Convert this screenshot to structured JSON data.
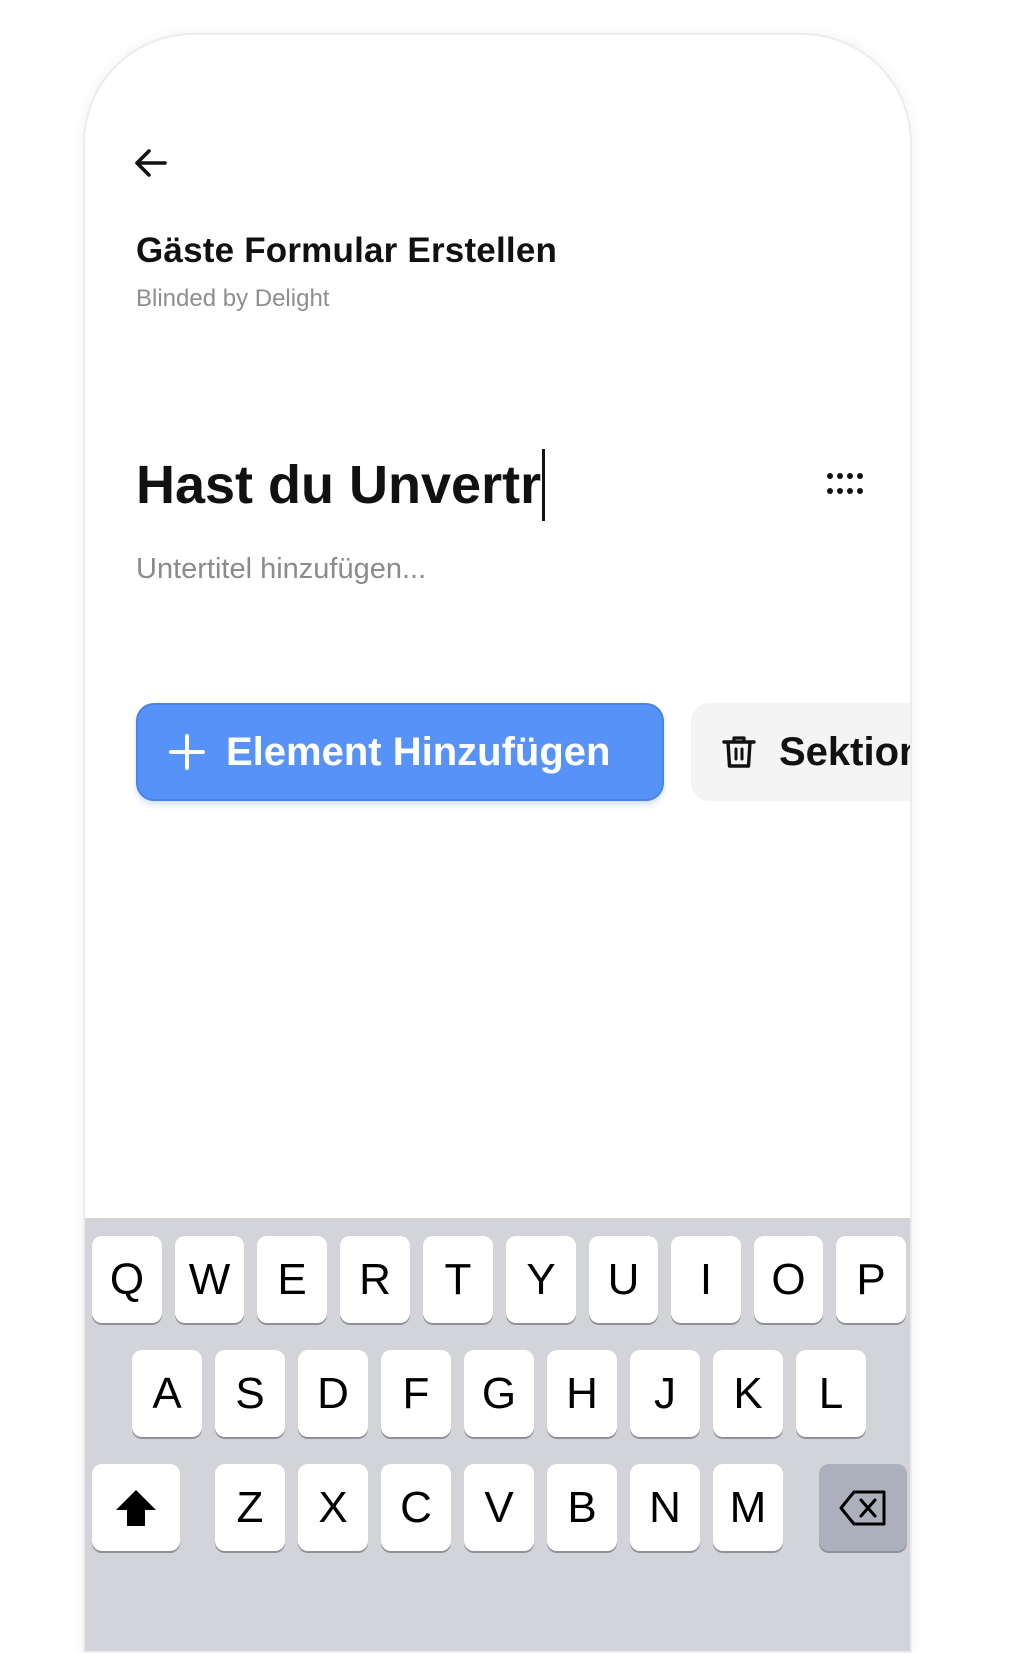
{
  "header": {
    "back_icon": "arrow-left-icon",
    "title": "Gäste Formular Erstellen",
    "subtitle": "Blinded by Delight"
  },
  "section": {
    "title_value": "Hast du Unvertr",
    "subtitle_placeholder": "Untertitel hinzufügen...",
    "drag_icon": "drag-handle-icon"
  },
  "actions": {
    "add_element_label": "Element Hinzufügen",
    "delete_section_label": "Sektion",
    "accent_color": "#5792f8"
  },
  "keyboard": {
    "row1": [
      "Q",
      "W",
      "E",
      "R",
      "T",
      "Y",
      "U",
      "I",
      "O",
      "P"
    ],
    "row2": [
      "A",
      "S",
      "D",
      "F",
      "G",
      "H",
      "J",
      "K",
      "L"
    ],
    "row3": [
      "Z",
      "X",
      "C",
      "V",
      "B",
      "N",
      "M"
    ],
    "shift_icon": "shift-arrow-icon",
    "backspace_icon": "backspace-icon"
  }
}
